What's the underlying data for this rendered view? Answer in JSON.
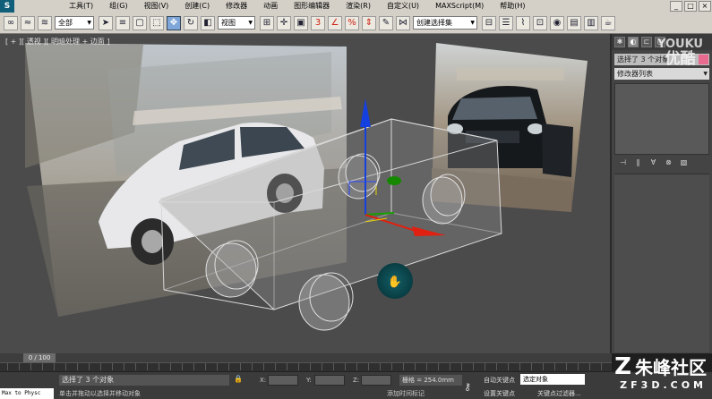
{
  "menu": {
    "items": [
      "工具(T)",
      "组(G)",
      "视图(V)",
      "创建(C)",
      "修改器",
      "动画",
      "图形编辑器",
      "渲染(R)",
      "自定义(U)",
      "MAXScript(M)",
      "帮助(H)"
    ],
    "window_controls": [
      "_",
      "□",
      "×"
    ]
  },
  "toolbar": {
    "selection_filter": "全部",
    "ref_coord": "视图",
    "named_selection_set": "创建选择集"
  },
  "viewport": {
    "label": "[ + ][ 透视 ][ 明暗处理 + 边面 ]",
    "reference_colors": {
      "box_edge": "#d8d8d8",
      "axis_z": "#1540e0",
      "axis_y": "#16a000",
      "axis_x": "#e02010",
      "sphere": "#0c4a50"
    }
  },
  "command_panel": {
    "object_name": "选择了 3 个对象",
    "object_color": "#e86a8e",
    "modifier_list": "修改器列表"
  },
  "timeline": {
    "frame_counter": "0 / 100"
  },
  "status": {
    "listener_text": "Max to Physc",
    "selection_info": "选择了 3 个对象",
    "prompt": "单击并拖动以选择并移动对象",
    "coord_labels": [
      "X:",
      "Y:",
      "Z:"
    ],
    "grid": "栅格 = 254.0mm",
    "add_time_tag": "添加时间标记",
    "auto_key": "自动关键点",
    "set_key": "设置关键点",
    "selected_dropdown": "选定对象",
    "key_filters": "关键点过滤器..."
  },
  "watermarks": {
    "youku_en": "YOUKU",
    "youku_cn": "优酷",
    "zf_cn": "朱峰社区",
    "zf_url": "ZF3D.COM"
  }
}
